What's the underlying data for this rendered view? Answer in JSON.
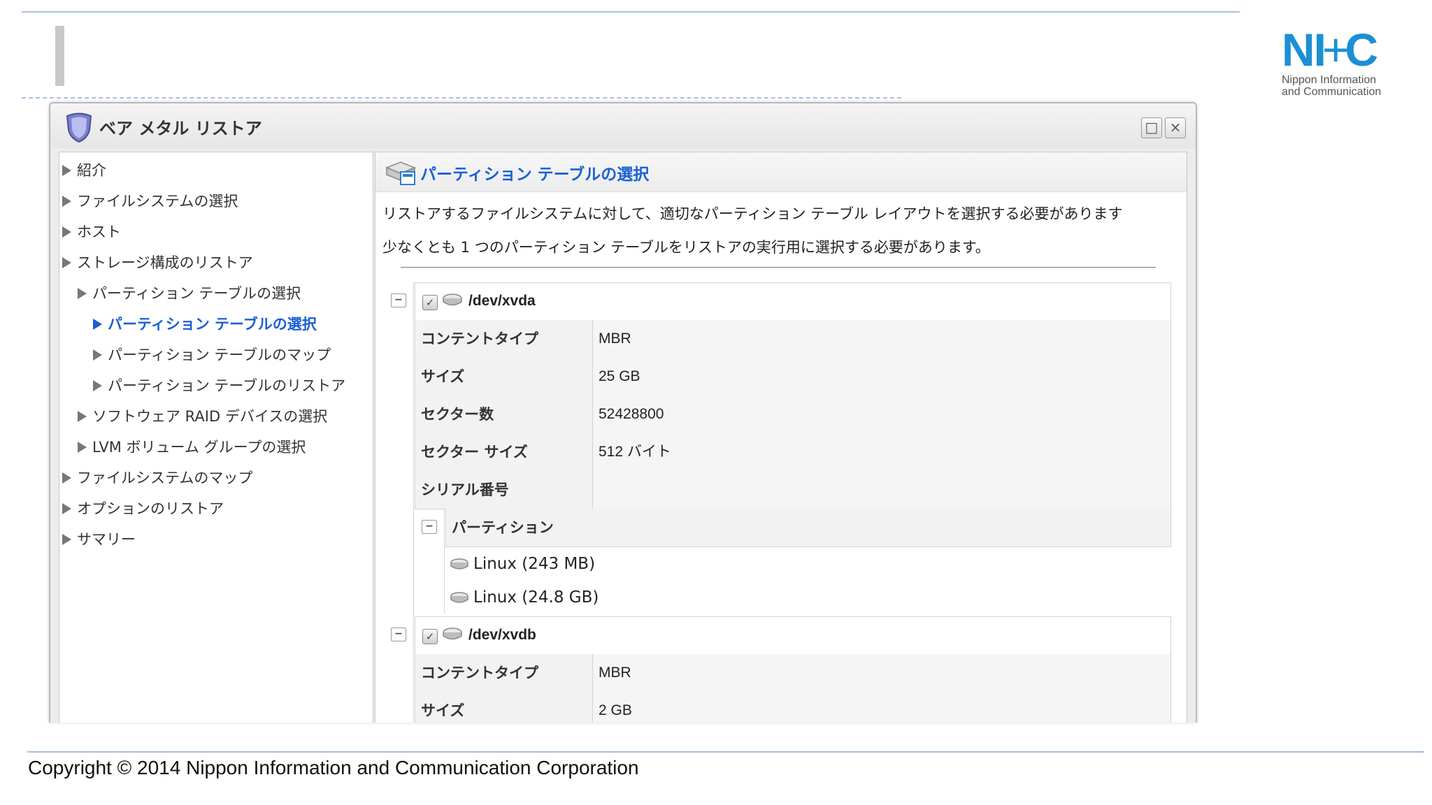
{
  "window": {
    "title": "ベア メタル リストア",
    "maximize_glyph": "□",
    "close_glyph": "×"
  },
  "nav": {
    "items": [
      {
        "label": "紹介",
        "level": 0,
        "active": false
      },
      {
        "label": "ファイルシステムの選択",
        "level": 0,
        "active": false
      },
      {
        "label": "ホスト",
        "level": 0,
        "active": false
      },
      {
        "label": "ストレージ構成のリストア",
        "level": 0,
        "active": false
      },
      {
        "label": "パーティション テーブルの選択",
        "level": 1,
        "active": false
      },
      {
        "label": "パーティション テーブルの選択",
        "level": 2,
        "active": true
      },
      {
        "label": "パーティション テーブルのマップ",
        "level": 2,
        "active": false
      },
      {
        "label": "パーティション テーブルのリストア",
        "level": 2,
        "active": false
      },
      {
        "label": "ソフトウェア RAID デバイスの選択",
        "level": 1,
        "active": false
      },
      {
        "label": "LVM ボリューム グループの選択",
        "level": 1,
        "active": false
      },
      {
        "label": "ファイルシステムのマップ",
        "level": 0,
        "active": false
      },
      {
        "label": "オプションのリストア",
        "level": 0,
        "active": false
      },
      {
        "label": "サマリー",
        "level": 0,
        "active": false
      }
    ]
  },
  "content": {
    "title": "パーティション テーブルの選択",
    "desc1": "リストアするファイルシステムに対して、適切なパーティション テーブル レイアウトを選択する必要があります",
    "desc2": "少なくとも 1 つのパーティション テーブルをリストアの実行用に選択する必要があります。"
  },
  "disks": [
    {
      "name": "/dev/xvda",
      "checked": true,
      "props": {
        "content_type_label": "コンテントタイプ",
        "content_type": "MBR",
        "size_label": "サイズ",
        "size": "25 GB",
        "sectors_label": "セクター数",
        "sectors": "52428800",
        "sector_size_label": "セクター サイズ",
        "sector_size": "512 バイト",
        "serial_label": "シリアル番号",
        "serial": ""
      },
      "partitions_label": "パーティション",
      "partitions": [
        "Linux (243 MB)",
        "Linux (24.8 GB)"
      ]
    },
    {
      "name": "/dev/xvdb",
      "checked": true,
      "props": {
        "content_type_label": "コンテントタイプ",
        "content_type": "MBR",
        "size_label": "サイズ",
        "size": "2 GB"
      }
    }
  ],
  "toggle_glyph": "−",
  "check_glyph": "✓",
  "footer": {
    "copyright": "Copyright © 2014 Nippon Information and Communication Corporation"
  },
  "logo": {
    "mark_left": "NI",
    "mark_plus": "+",
    "mark_right": "C",
    "line1": "Nippon Information",
    "line2": "and Communication"
  }
}
